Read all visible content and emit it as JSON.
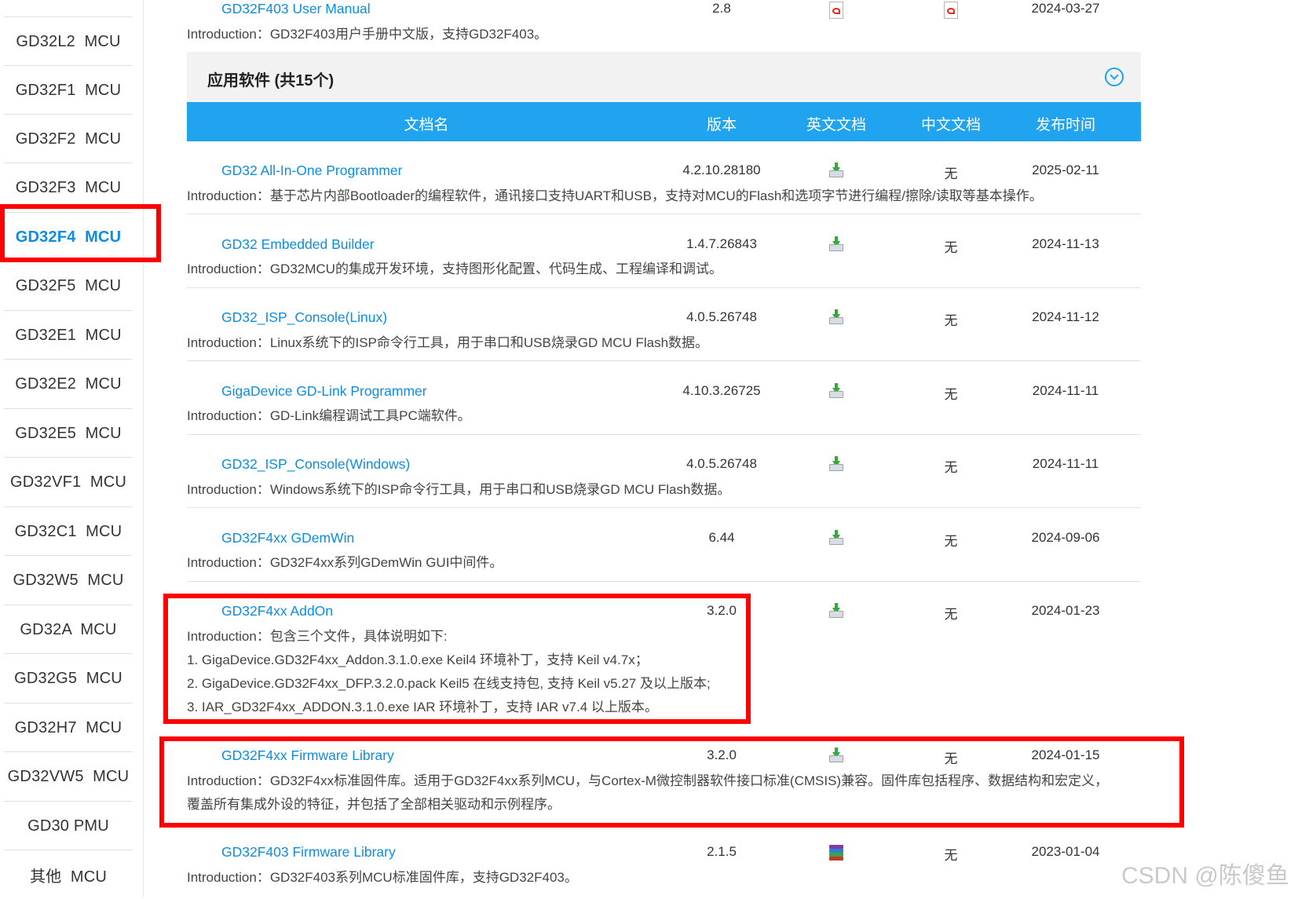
{
  "sidebar": {
    "items": [
      {
        "label": "GD32L2  MCU",
        "active": false
      },
      {
        "label": "GD32F1  MCU",
        "active": false
      },
      {
        "label": "GD32F2  MCU",
        "active": false
      },
      {
        "label": "GD32F3  MCU",
        "active": false
      },
      {
        "label": "GD32F4  MCU",
        "active": true
      },
      {
        "label": "GD32F5  MCU",
        "active": false
      },
      {
        "label": "GD32E1  MCU",
        "active": false
      },
      {
        "label": "GD32E2  MCU",
        "active": false
      },
      {
        "label": "GD32E5  MCU",
        "active": false
      },
      {
        "label": "GD32VF1  MCU",
        "active": false
      },
      {
        "label": "GD32C1  MCU",
        "active": false
      },
      {
        "label": "GD32W5  MCU",
        "active": false
      },
      {
        "label": "GD32A  MCU",
        "active": false
      },
      {
        "label": "GD32G5  MCU",
        "active": false
      },
      {
        "label": "GD32H7  MCU",
        "active": false
      },
      {
        "label": "GD32VW5  MCU",
        "active": false
      },
      {
        "label": "GD30 PMU",
        "active": false
      },
      {
        "label": "其他  MCU",
        "active": false
      }
    ]
  },
  "prev_row": {
    "name": "GD32F403 User Manual",
    "version": "2.8",
    "en_doc_icon": "pdf-icon",
    "zh_doc_icon": "pdf-icon",
    "date": "2024-03-27",
    "intro": "Introduction：GD32F403用户手册中文版，支持GD32F403。"
  },
  "section": {
    "title": "应用软件 (共15个)",
    "collapse_icon": "chevron-down-circle-icon"
  },
  "table": {
    "headers": {
      "name": "文档名",
      "version": "版本",
      "en": "英文文档",
      "zh": "中文文档",
      "date": "发布时间"
    },
    "rows": [
      {
        "name": "GD32 All-In-One Programmer",
        "version": "4.2.10.28180",
        "en_icon": "download-icon",
        "zh": "无",
        "date": "2025-02-11",
        "intro": [
          "Introduction：基于芯片内部Bootloader的编程软件，通讯接口支持UART和USB，支持对MCU的Flash和选项字节进行编程/擦除/读取等基本操作。"
        ]
      },
      {
        "name": "GD32 Embedded Builder",
        "version": "1.4.7.26843",
        "en_icon": "download-icon",
        "zh": "无",
        "date": "2024-11-13",
        "intro": [
          "Introduction：GD32MCU的集成开发环境，支持图形化配置、代码生成、工程编译和调试。"
        ]
      },
      {
        "name": "GD32_ISP_Console(Linux)",
        "version": "4.0.5.26748",
        "en_icon": "download-icon",
        "zh": "无",
        "date": "2024-11-12",
        "intro": [
          "Introduction：Linux系统下的ISP命令行工具，用于串口和USB烧录GD MCU Flash数据。"
        ]
      },
      {
        "name": "GigaDevice GD-Link Programmer",
        "version": "4.10.3.26725",
        "en_icon": "download-icon",
        "zh": "无",
        "date": "2024-11-11",
        "intro": [
          "Introduction：GD-Link编程调试工具PC端软件。"
        ]
      },
      {
        "name": "GD32_ISP_Console(Windows)",
        "version": "4.0.5.26748",
        "en_icon": "download-icon",
        "zh": "无",
        "date": "2024-11-11",
        "intro": [
          "Introduction：Windows系统下的ISP命令行工具，用于串口和USB烧录GD MCU Flash数据。"
        ]
      },
      {
        "name": "GD32F4xx GDemWin",
        "version": "6.44",
        "en_icon": "download-icon",
        "zh": "无",
        "date": "2024-09-06",
        "intro": [
          "Introduction：GD32F4xx系列GDemWin GUI中间件。"
        ]
      },
      {
        "name": "GD32F4xx AddOn",
        "version": "3.2.0",
        "en_icon": "download-icon",
        "zh": "无",
        "date": "2024-01-23",
        "intro": [
          "Introduction：包含三个文件，具体说明如下:",
          "1. GigaDevice.GD32F4xx_Addon.3.1.0.exe Keil4 环境补丁，支持 Keil v4.7x；",
          "2. GigaDevice.GD32F4xx_DFP.3.2.0.pack Keil5 在线支持包, 支持 Keil v5.27 及以上版本;",
          "3. IAR_GD32F4xx_ADDON.3.1.0.exe IAR 环境补丁，支持 IAR v7.4 以上版本。"
        ]
      },
      {
        "name": "GD32F4xx Firmware Library",
        "version": "3.2.0",
        "en_icon": "download-icon",
        "zh": "无",
        "date": "2024-01-15",
        "intro": [
          "Introduction：GD32F4xx标准固件库。适用于GD32F4xx系列MCU，与Cortex-M微控制器软件接口标准(CMSIS)兼容。固件库包括程序、数据结构和宏定义，",
          "覆盖所有集成外设的特征，并包括了全部相关驱动和示例程序。"
        ]
      },
      {
        "name": "GD32F403 Firmware Library",
        "version": "2.1.5",
        "en_icon": "archive-icon",
        "zh": "无",
        "date": "2023-01-04",
        "intro": [
          "Introduction：GD32F403系列MCU标准固件库，支持GD32F403。"
        ]
      }
    ]
  },
  "watermark": "CSDN @陈傻鱼",
  "colors": {
    "link": "#0b8ee0",
    "header_bg": "#21a4ef",
    "highlight": "#ff0000"
  }
}
